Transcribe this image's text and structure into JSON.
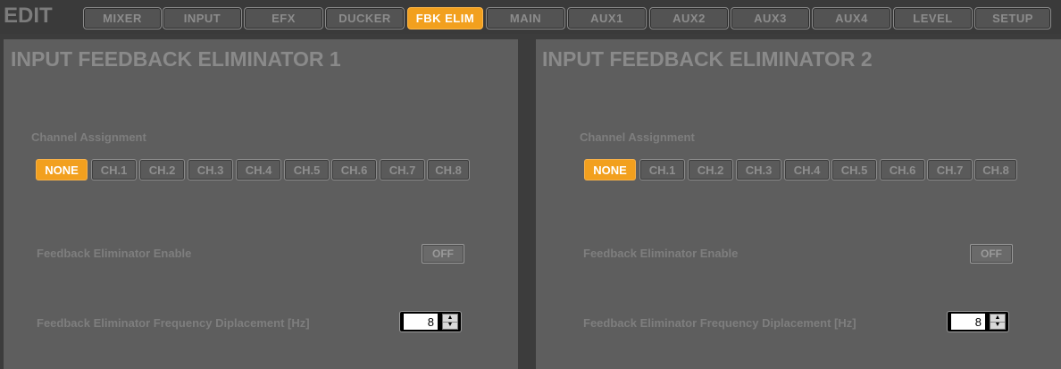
{
  "header": {
    "title": "EDIT"
  },
  "tabs": [
    {
      "label": "MIXER",
      "active": false
    },
    {
      "label": "INPUT",
      "active": false
    },
    {
      "label": "EFX",
      "active": false
    },
    {
      "label": "DUCKER",
      "active": false
    },
    {
      "label": "FBK ELIM",
      "active": true
    },
    {
      "label": "MAIN",
      "active": false
    },
    {
      "label": "AUX1",
      "active": false
    },
    {
      "label": "AUX2",
      "active": false
    },
    {
      "label": "AUX3",
      "active": false
    },
    {
      "label": "AUX4",
      "active": false
    },
    {
      "label": "LEVEL",
      "active": false
    },
    {
      "label": "SETUP",
      "active": false
    }
  ],
  "panels": [
    {
      "title": "INPUT FEEDBACK ELIMINATOR 1",
      "channel_label": "Channel Assignment",
      "channels": [
        "NONE",
        "CH.1",
        "CH.2",
        "CH.3",
        "CH.4",
        "CH.5",
        "CH.6",
        "CH.7",
        "CH.8"
      ],
      "selected_channel": "NONE",
      "enable_label": "Feedback Eliminator Enable",
      "enable_value": "OFF",
      "freq_label": "Feedback Eliminator Frequency Diplacement [Hz]",
      "freq_value": "8"
    },
    {
      "title": "INPUT FEEDBACK ELIMINATOR 2",
      "channel_label": "Channel Assignment",
      "channels": [
        "NONE",
        "CH.1",
        "CH.2",
        "CH.3",
        "CH.4",
        "CH.5",
        "CH.6",
        "CH.7",
        "CH.8"
      ],
      "selected_channel": "NONE",
      "enable_label": "Feedback Eliminator Enable",
      "enable_value": "OFF",
      "freq_label": "Feedback Eliminator Frequency Diplacement [Hz]",
      "freq_value": "8"
    }
  ],
  "colors": {
    "accent": "#f2a01e",
    "panel_bg": "#5e5e5e",
    "app_bg": "#3c3c3c"
  }
}
